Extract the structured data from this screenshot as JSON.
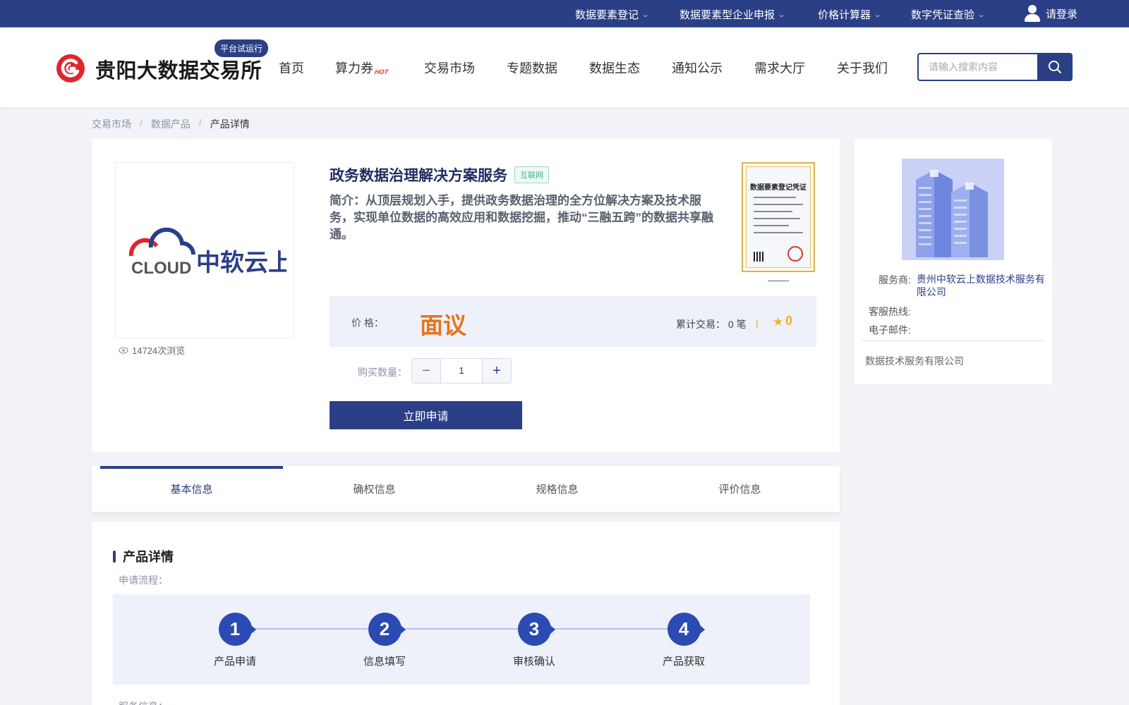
{
  "topbar": {
    "items": [
      "数据要素登记",
      "数据要素型企业申报",
      "价格计算器",
      "数字凭证查验"
    ],
    "login": "请登录"
  },
  "header": {
    "brand": "贵阳大数据交易所",
    "badge": "平台试运行",
    "nav": [
      "首页",
      "算力券",
      "交易市场",
      "专题数据",
      "数据生态",
      "通知公示",
      "需求大厅",
      "关于我们"
    ],
    "hot_tag": "HOT",
    "search_placeholder": "请输入搜索内容"
  },
  "breadcrumb": [
    "交易市场",
    "数据产品",
    "产品详情"
  ],
  "product": {
    "logo_text_en": "CLOUD",
    "logo_text_cn": "中软云上",
    "views": "14724次浏览",
    "title": "政务数据治理解决方案服务",
    "tag": "互联网",
    "intro": "简介：从顶层规划入手，提供政务数据治理的全方位解决方案及技术服务，实现单位数据的高效应用和数据挖掘，推动“三融五跨”的数据共享融通。",
    "certificate_title": "数据要素登记凭证",
    "price_label": "价 格：",
    "price": "面议",
    "trade_count": "累计交易： 0 笔",
    "rating": "0",
    "qty_label": "购买数量：",
    "qty": "1",
    "apply": "立即申请"
  },
  "provider": {
    "service_label": "服务商:",
    "service_value": "贵州中软云上数据技术服务有限公司",
    "hotline_label": "客服热线:",
    "email_label": "电子邮件:",
    "company": "数据技术服务有限公司"
  },
  "tabs": [
    "基本信息",
    "确权信息",
    "规格信息",
    "评价信息"
  ],
  "detail": {
    "section_title": "产品详情",
    "process_label": "申请流程：",
    "steps": [
      {
        "num": "1",
        "label": "产品申请"
      },
      {
        "num": "2",
        "label": "信息填写"
      },
      {
        "num": "3",
        "label": "审核确认"
      },
      {
        "num": "4",
        "label": "产品获取"
      }
    ],
    "service_info_label": "服务信息："
  },
  "colors": {
    "primary": "#2b3f86",
    "accent_orange": "#e5741c",
    "star": "#f0b323",
    "tag_green": "#3bb28d"
  },
  "icons": [
    "chevron-down-icon",
    "user-icon",
    "search-icon",
    "eye-icon",
    "star-icon",
    "minus-icon",
    "plus-icon"
  ]
}
